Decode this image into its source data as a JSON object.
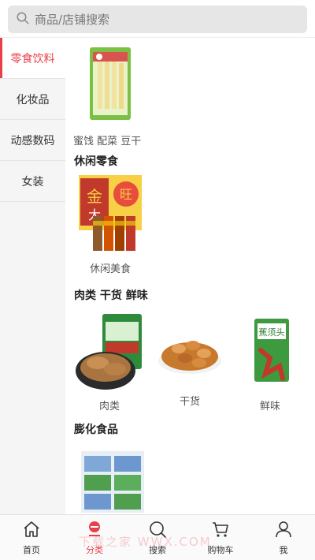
{
  "search": {
    "placeholder": "商品/店铺搜索"
  },
  "sidebar": {
    "items": [
      {
        "label": "零食饮料",
        "active": true
      },
      {
        "label": "化妆品",
        "active": false
      },
      {
        "label": "动感数码",
        "active": false
      },
      {
        "label": "女装",
        "active": false
      }
    ]
  },
  "content": {
    "top_product": {
      "label": "蜜饯 配菜 豆干"
    },
    "sections": [
      {
        "title": "休闲零食",
        "products": [
          {
            "label": "休闲美食"
          }
        ]
      },
      {
        "title": "肉类 干货 鲜味",
        "products": [
          {
            "label": "肉类"
          },
          {
            "label": "干货"
          },
          {
            "label": "鲜味"
          }
        ]
      },
      {
        "title": "膨化食品",
        "products": []
      }
    ]
  },
  "tabbar": {
    "items": [
      {
        "label": "首页",
        "icon": "home-icon"
      },
      {
        "label": "分类",
        "icon": "category-icon",
        "active": true
      },
      {
        "label": "搜索",
        "icon": "search-icon"
      },
      {
        "label": "购物车",
        "icon": "cart-icon"
      },
      {
        "label": "我",
        "icon": "user-icon"
      }
    ]
  },
  "watermark": "下载之家 WWX.COM",
  "colors": {
    "accent": "#e8404a",
    "sidebar_bg": "#f5f5f5",
    "search_bg": "#e6e6e6"
  }
}
